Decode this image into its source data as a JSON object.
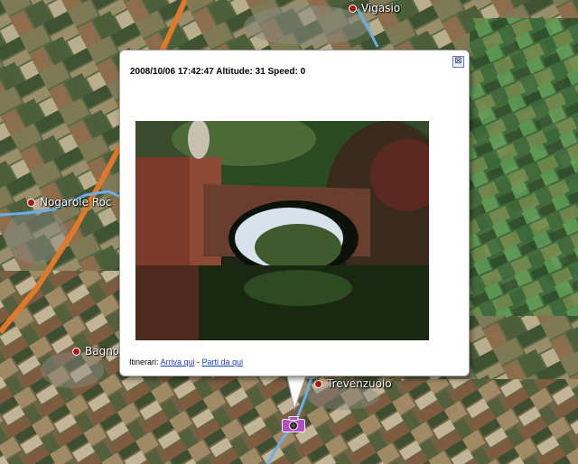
{
  "places": [
    {
      "name": "Vigasio"
    },
    {
      "name": "Nogarole Roc"
    },
    {
      "name": "Bagno"
    },
    {
      "name": "Trevenzuolo"
    }
  ],
  "balloon": {
    "info": "2008/10/06 17:42:47 Altitude: 31 Speed: 0",
    "directions_label": "Itinerari:",
    "link_to": "Arriva qui",
    "separator": " - ",
    "link_from": "Parti da qui",
    "close_glyph": "⊠"
  },
  "colors": {
    "route_orange": "#e0782a",
    "track_blue": "#6aaee6",
    "place_dot": "#b01515",
    "link": "#1a3ecc",
    "camera": "#b84cc8"
  },
  "icons": [
    "close-icon",
    "camera-icon",
    "place-dot-icon"
  ]
}
